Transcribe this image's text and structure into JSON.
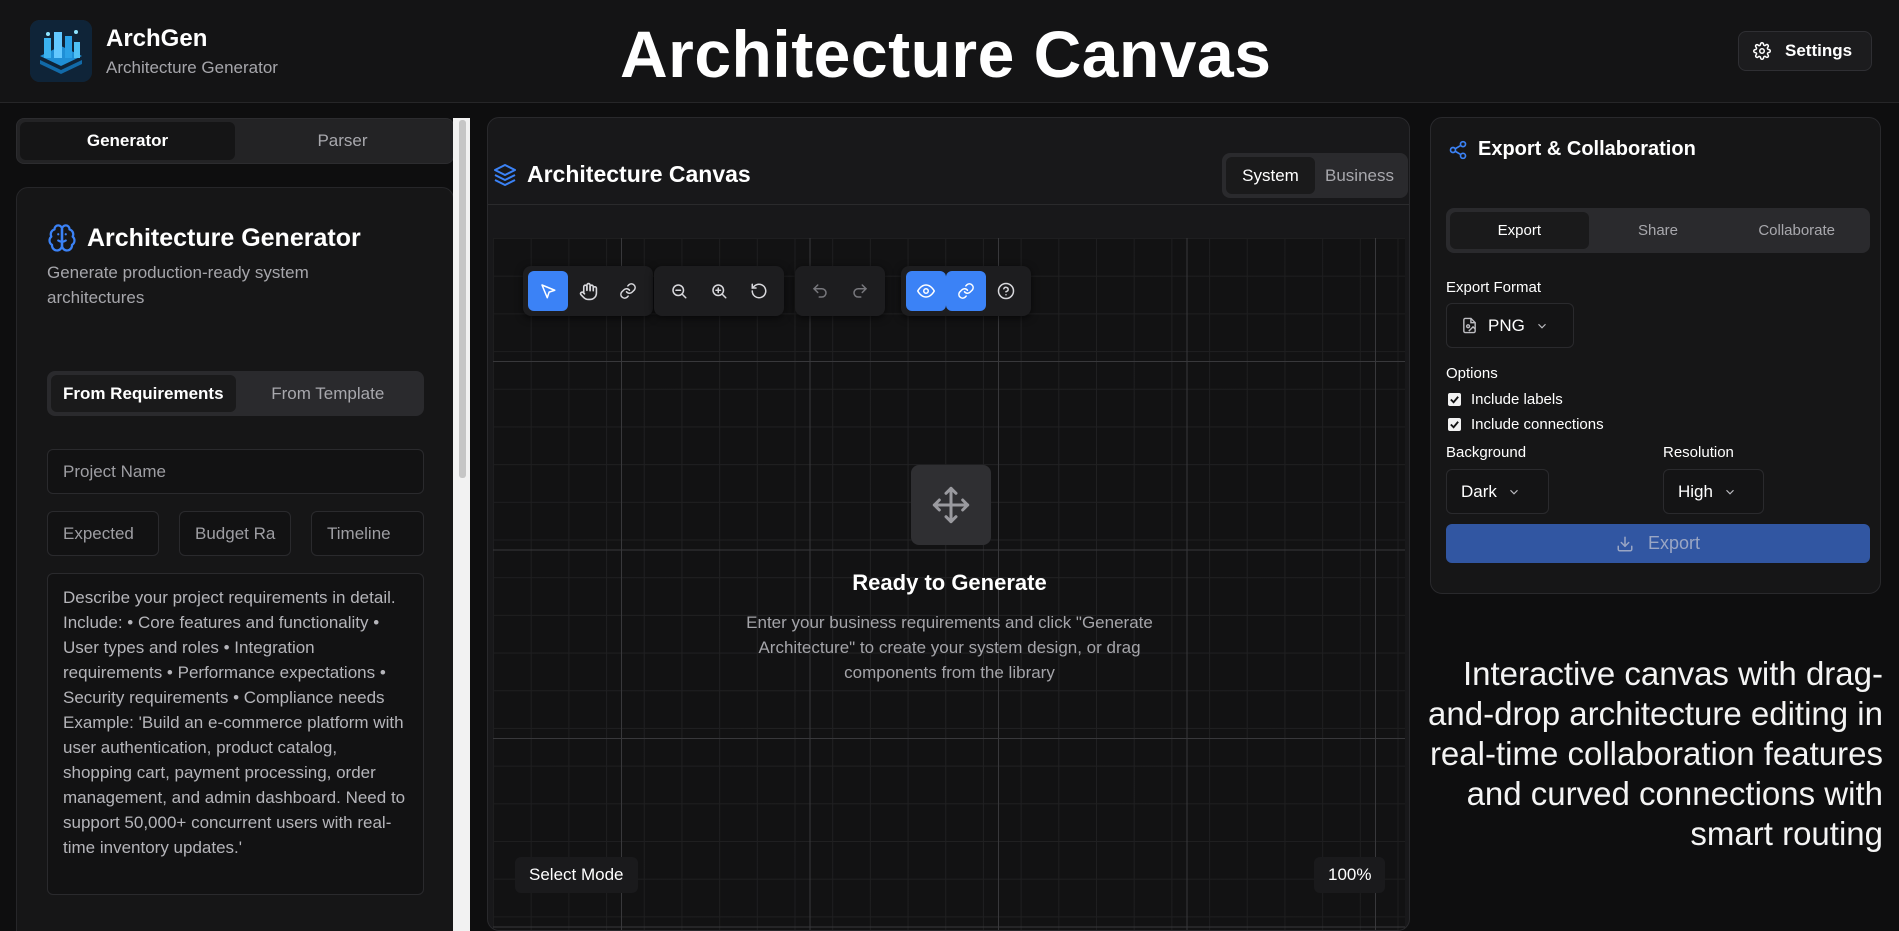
{
  "header": {
    "brand_name": "ArchGen",
    "brand_subtitle": "Architecture Generator",
    "hero_title": "Architecture Canvas",
    "settings_label": "Settings"
  },
  "left_panel": {
    "tabs": [
      {
        "label": "Generator",
        "active": true
      },
      {
        "label": "Parser",
        "active": false
      }
    ],
    "generator": {
      "title": "Architecture Generator",
      "subtitle": "Generate production-ready system architectures",
      "mode_tabs": [
        {
          "label": "From Requirements",
          "active": true
        },
        {
          "label": "From Template",
          "active": false
        }
      ],
      "project_name_placeholder": "Project Name",
      "expected_placeholder": "Expected",
      "budget_placeholder": "Budget Ra",
      "timeline_placeholder": "Timeline",
      "requirements_placeholder": "Describe your project requirements in detail. Include:   • Core features and functionality   • User types and roles   • Integration requirements   • Performance expectations   • Security requirements   • Compliance needs      Example: 'Build an e-commerce platform with user authentication, product catalog, shopping cart, payment processing, order management, and admin dashboard. Need to support 50,000+ concurrent users with real-time inventory updates.'"
    }
  },
  "canvas": {
    "title": "Architecture Canvas",
    "view_tabs": [
      {
        "label": "System",
        "active": true
      },
      {
        "label": "Business",
        "active": false
      }
    ],
    "toolbar_icons": [
      "pointer-icon",
      "hand-icon",
      "link-icon",
      "zoom-out-icon",
      "zoom-in-icon",
      "reset-icon",
      "undo-icon",
      "redo-icon",
      "eye-icon",
      "link-icon",
      "help-icon"
    ],
    "empty_title": "Ready to Generate",
    "empty_description": "Enter your business requirements and click \"Generate Architecture\" to create your system design, or drag components from the library",
    "mode_label": "Select Mode",
    "zoom_label": "100%"
  },
  "export_panel": {
    "title": "Export & Collaboration",
    "tabs": [
      {
        "label": "Export",
        "active": true
      },
      {
        "label": "Share",
        "active": false
      },
      {
        "label": "Collaborate",
        "active": false
      }
    ],
    "format_label": "Export Format",
    "format_value": "PNG",
    "options_label": "Options",
    "options": [
      {
        "label": "Include labels",
        "checked": true
      },
      {
        "label": "Include connections",
        "checked": true
      }
    ],
    "background_label": "Background",
    "background_value": "Dark",
    "resolution_label": "Resolution",
    "resolution_value": "High",
    "export_button": "Export"
  },
  "caption": "Interactive canvas with drag-and-drop architecture editing in real-time collaboration features and curved connections with smart routing",
  "colors": {
    "accent": "#3b82f6",
    "background": "#0e0e0f",
    "panel": "#161617"
  }
}
